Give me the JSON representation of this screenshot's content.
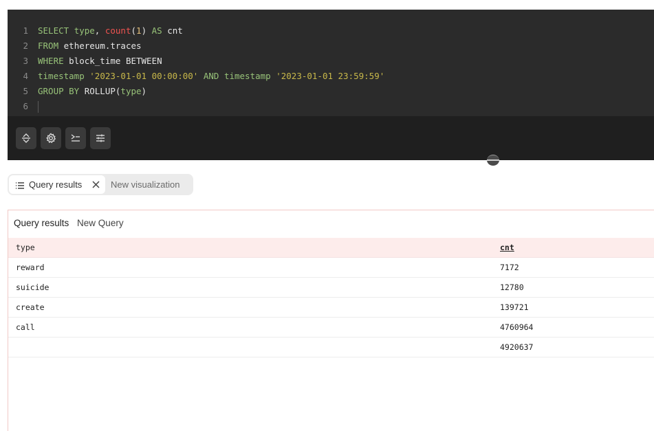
{
  "editor": {
    "lines": [
      {
        "no": "1",
        "tokens": [
          {
            "t": "SELECT ",
            "c": "kw"
          },
          {
            "t": "type",
            "c": "kw"
          },
          {
            "t": ", ",
            "c": "id"
          },
          {
            "t": "count",
            "c": "fn"
          },
          {
            "t": "(",
            "c": "id"
          },
          {
            "t": "1",
            "c": "num"
          },
          {
            "t": ") ",
            "c": "id"
          },
          {
            "t": "AS ",
            "c": "kw"
          },
          {
            "t": "cnt",
            "c": "id"
          }
        ]
      },
      {
        "no": "2",
        "tokens": [
          {
            "t": "FROM ",
            "c": "kw"
          },
          {
            "t": "ethereum.traces",
            "c": "id"
          }
        ]
      },
      {
        "no": "3",
        "tokens": [
          {
            "t": "WHERE ",
            "c": "kw"
          },
          {
            "t": "block_time BETWEEN",
            "c": "id"
          }
        ]
      },
      {
        "no": "4",
        "tokens": [
          {
            "t": "timestamp ",
            "c": "kw"
          },
          {
            "t": "'2023-01-01 00:00:00'",
            "c": "str"
          },
          {
            "t": " AND ",
            "c": "kw"
          },
          {
            "t": "timestamp ",
            "c": "kw"
          },
          {
            "t": "'2023-01-01 23:59:59'",
            "c": "str"
          }
        ]
      },
      {
        "no": "5",
        "tokens": [
          {
            "t": "GROUP BY ",
            "c": "kw"
          },
          {
            "t": "ROLLUP",
            "c": "id"
          },
          {
            "t": "(",
            "c": "id"
          },
          {
            "t": "type",
            "c": "kw"
          },
          {
            "t": ")",
            "c": "id"
          }
        ]
      },
      {
        "no": "6",
        "tokens": []
      }
    ]
  },
  "toolbar": {
    "buttons": [
      {
        "name": "collapse-expand-icon"
      },
      {
        "name": "settings-gear-icon"
      },
      {
        "name": "indent-format-icon"
      },
      {
        "name": "sliders-options-icon"
      }
    ]
  },
  "tabs": {
    "active_label": "Query results",
    "inactive_label": "New visualization"
  },
  "results": {
    "title": "Query results",
    "subtitle": "New Query",
    "columns": [
      "type",
      "cnt"
    ],
    "rows": [
      [
        "reward",
        "7172"
      ],
      [
        "suicide",
        "12780"
      ],
      [
        "create",
        "139721"
      ],
      [
        "call",
        "4760964"
      ],
      [
        "",
        "4920637"
      ]
    ]
  }
}
